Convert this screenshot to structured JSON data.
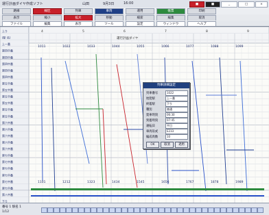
{
  "window": {
    "title": "運行計画ダイヤ作成ソフト",
    "user": "山田",
    "date": "9月3日",
    "time": "16:00"
  },
  "toolbar1": {
    "items": [
      "路線",
      "線区",
      "列車",
      "車両",
      "運用",
      "帳票",
      "印刷"
    ]
  },
  "toolbar2": {
    "items": [
      "表示",
      "縮小",
      "拡大",
      "移動",
      "検索",
      "編集",
      "取消"
    ]
  },
  "toolbar3": {
    "items": [
      "ファイル",
      "編集",
      "表示",
      "ツール",
      "設定",
      "ウィンドウ",
      "ヘルプ"
    ]
  },
  "header": {
    "title": "運行計画ダイヤ",
    "col_labels": [
      "4",
      "5",
      "6",
      "7",
      "8",
      "9"
    ]
  },
  "stations": [
    "上り",
    "(駅 名)",
    "上一番",
    "第四中番",
    "第四中番",
    "第四中番",
    "第四中番",
    "第四中番",
    "第五中番",
    "第五中番",
    "第五中番",
    "第五中番",
    "第五中番",
    "第五中番",
    "第六中番",
    "第六中番",
    "第六中番",
    "第六中番",
    "第六中番",
    "第七中番",
    "第七中番",
    "第七中番",
    "第七中番",
    "第七中番",
    "第七中番",
    "第八中番",
    "下り"
  ],
  "train_labels": [
    "1011",
    "1022",
    "1033",
    "1044",
    "1055",
    "1066",
    "1077",
    "1088",
    "1099",
    "1101",
    "1212",
    "1323",
    "1434",
    "1545",
    "1656",
    "1767",
    "1878",
    "1989"
  ],
  "dialog": {
    "title": "列車詳細設定",
    "fields": [
      {
        "label": "列車番号",
        "value": "1022"
      },
      {
        "label": "始発駅",
        "value": "上一番"
      },
      {
        "label": "終着駅",
        "value": "下り"
      },
      {
        "label": "種別",
        "value": "普通"
      },
      {
        "label": "発車時刻",
        "value": "06:30"
      },
      {
        "label": "到着時刻",
        "value": "07:45"
      },
      {
        "label": "運転日",
        "value": "平日"
      },
      {
        "label": "車両形式",
        "value": "E233"
      },
      {
        "label": "編成両数",
        "value": "10"
      }
    ],
    "buttons": [
      "OK",
      "取消",
      "適用"
    ]
  },
  "status": {
    "left": "番号 1 駅名 1",
    "page": "1/12"
  }
}
